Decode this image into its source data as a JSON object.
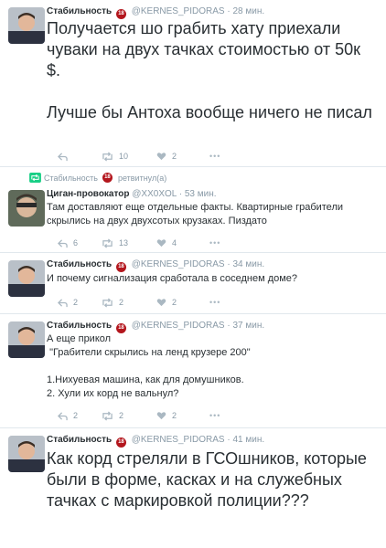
{
  "badge_text": "18",
  "tweets": [
    {
      "name": "Стабильность",
      "handle": "@KERNES_PIDORAS",
      "time": "28 мин.",
      "text": "Получается шо грабить хату приехали чуваки на двух тачках стоимостью от 50к $.\n\nЛучше бы Антоха вообще ничего не писал",
      "retweets": "10",
      "likes": "2"
    },
    {
      "context_name": "Стабильность",
      "context_action": "ретвитнул(а)",
      "name": "Циган-провокатор",
      "handle": "@XX0XOL",
      "time": "53 мин.",
      "text": "Там доставляют еще отдельные факты. Квартирные грабители скрылись на двух двухсотых крузаках. Пиздато",
      "replies": "6",
      "retweets": "13",
      "likes": "4"
    },
    {
      "name": "Стабильность",
      "handle": "@KERNES_PIDORAS",
      "time": "34 мин.",
      "text": "И почему сигнализация сработала в соседнем доме?",
      "replies": "2",
      "retweets": "2",
      "likes": "2"
    },
    {
      "name": "Стабильность",
      "handle": "@KERNES_PIDORAS",
      "time": "37 мин.",
      "text": "А еще прикол\n \"Грабители скрылись на ленд крузере 200\"\n\n1.Нихуевая машина, как для домушников.\n2. Хули их корд не вальнул?",
      "replies": "2",
      "retweets": "2",
      "likes": "2"
    },
    {
      "name": "Стабильность",
      "handle": "@KERNES_PIDORAS",
      "time": "41 мин.",
      "text": "Как корд стреляли в ГСОшников, которые были в форме, касках и на служебных тачках с маркировкой полиции???"
    }
  ]
}
